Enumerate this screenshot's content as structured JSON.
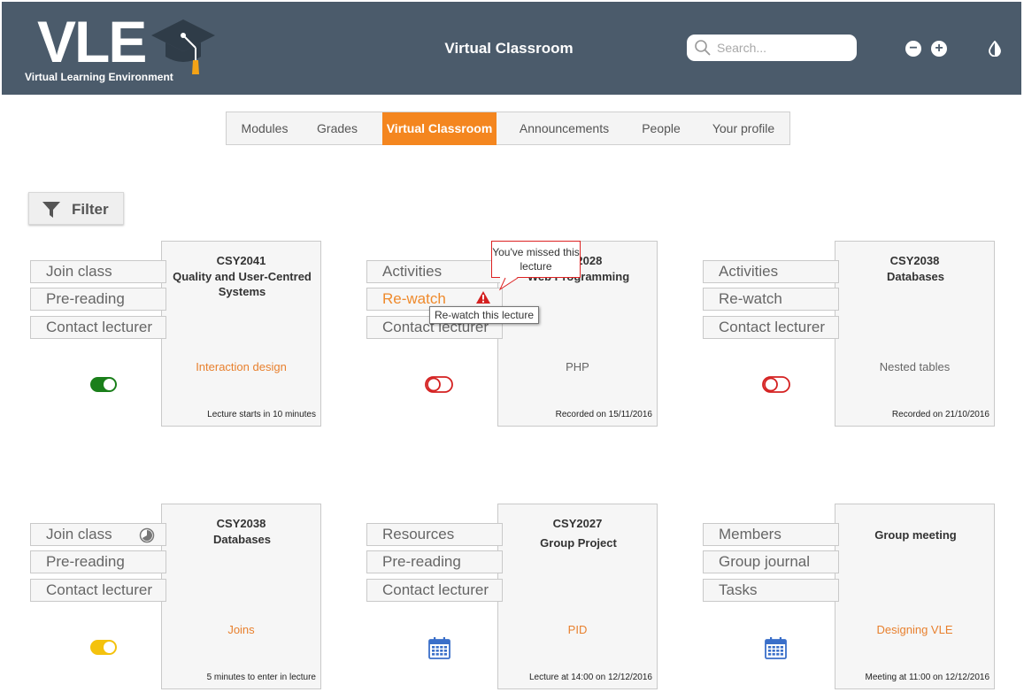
{
  "header": {
    "logo": "VLE",
    "logo_subtitle": "Virtual Learning Environment",
    "title": "Virtual Classroom",
    "search_placeholder": "Search...",
    "zoom_out": "−",
    "zoom_in": "+"
  },
  "tabs": [
    {
      "label": "Modules"
    },
    {
      "label": "Grades"
    },
    {
      "label": "Virtual Classroom",
      "active": true
    },
    {
      "label": "Announcements"
    },
    {
      "label": "People"
    },
    {
      "label": "Your profile"
    }
  ],
  "filter": {
    "label": "Filter"
  },
  "cards": [
    {
      "code": "CSY2041",
      "title": "Quality and User-Centred Systems",
      "topic": "Interaction design",
      "status": "Lecture starts in 10 minutes",
      "buttons": [
        "Join class",
        "Pre-reading",
        "Contact lecturer"
      ],
      "indicator": "toggle-on-green"
    },
    {
      "code": "CSY2028",
      "title": "Web Programming",
      "topic": "PHP",
      "status": "Recorded on 15/11/2016",
      "buttons": [
        "Activities",
        "Re-watch",
        "Contact lecturer"
      ],
      "indicator": "toggle-off-red",
      "bubble": "You've missed this lecture",
      "tooltip": "Re-watch this lecture"
    },
    {
      "code": "CSY2038",
      "title": "Databases",
      "topic": "Nested tables",
      "status": "Recorded on 21/10/2016",
      "buttons": [
        "Activities",
        "Re-watch",
        "Contact lecturer"
      ],
      "indicator": "toggle-off-red"
    },
    {
      "code": "CSY2038",
      "title": "Databases",
      "topic": "Joins",
      "status": "5 minutes to enter in lecture",
      "buttons": [
        "Join class",
        "Pre-reading",
        "Contact lecturer"
      ],
      "indicator": "toggle-on-yellow"
    },
    {
      "code": "CSY2027",
      "title": "Group Project",
      "topic": "PID",
      "status": "Lecture at 14:00 on 12/12/2016",
      "buttons": [
        "Resources",
        "Pre-reading",
        "Contact lecturer"
      ],
      "indicator": "calendar-icon"
    },
    {
      "code": "",
      "title": "Group meeting",
      "topic": "Designing VLE",
      "status": "Meeting at 11:00 on 12/12/2016",
      "buttons": [
        "Members",
        "Group journal",
        "Tasks"
      ],
      "indicator": "calendar-icon"
    }
  ],
  "colors": {
    "header_bg": "#4b5b6b",
    "accent": "#f4861f",
    "toggle_green": "#1a7f1a",
    "toggle_red": "#d42020",
    "toggle_yellow": "#f4c20d",
    "calendar_blue": "#3a6fc9"
  }
}
